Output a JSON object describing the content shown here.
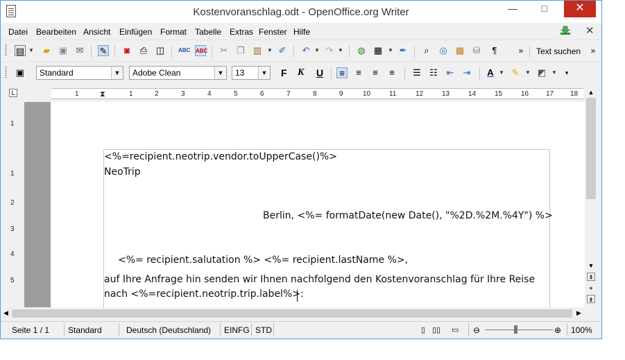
{
  "window": {
    "title": "Kostenvoranschlag.odt - OpenOffice.org Writer",
    "min_glyph": "—",
    "max_glyph": "□",
    "close_glyph": "✕"
  },
  "menu": {
    "items": [
      {
        "label": "Datei"
      },
      {
        "label": "Bearbeiten"
      },
      {
        "label": "Ansicht"
      },
      {
        "label": "Einfügen"
      },
      {
        "label": "Format"
      },
      {
        "label": "Tabelle"
      },
      {
        "label": "Extras"
      },
      {
        "label": "Fenster"
      },
      {
        "label": "Hilfe"
      }
    ],
    "doc_close_glyph": "✕"
  },
  "toolbar_standard": {
    "find_label": "Text suchen",
    "overflow_glyph": "»"
  },
  "toolbar_format": {
    "paragraph_style": "Standard",
    "font_name": "Adobe Clean",
    "font_size": "13",
    "bold": "F",
    "italic": "K",
    "underline": "U"
  },
  "ruler": {
    "corner": "L",
    "h_ticks": [
      "1",
      "1",
      "2",
      "3",
      "4",
      "5",
      "6",
      "7",
      "8",
      "9",
      "10",
      "11",
      "12",
      "13",
      "14",
      "15",
      "16",
      "17",
      "18"
    ],
    "v_ticks": [
      "1",
      "1",
      "2",
      "3",
      "4",
      "5"
    ]
  },
  "document": {
    "lines": [
      "<%=recipient.neotrip.vendor.toUpperCase()%>",
      "NeoTrip",
      "Berlin, <%= formatDate(new Date(), \"%2D.%2M.%4Y\") %>",
      "<%= recipient.salutation %> <%= recipient.lastName %>,",
      "auf Ihre Anfrage hin senden wir Ihnen nachfolgend den Kostenvoranschlag für Ihre Reise",
      "nach <%=recipient.neotrip.trip.label%>:"
    ]
  },
  "statusbar": {
    "page": "Seite 1 / 1",
    "style": "Standard",
    "language": "Deutsch (Deutschland)",
    "insert_mode": "EINFG",
    "selection_mode": "STD",
    "zoom": "100%",
    "zoom_level": 0.45
  },
  "colors": {
    "accent": "#5a9bd5",
    "close_button": "#c42b1c"
  }
}
